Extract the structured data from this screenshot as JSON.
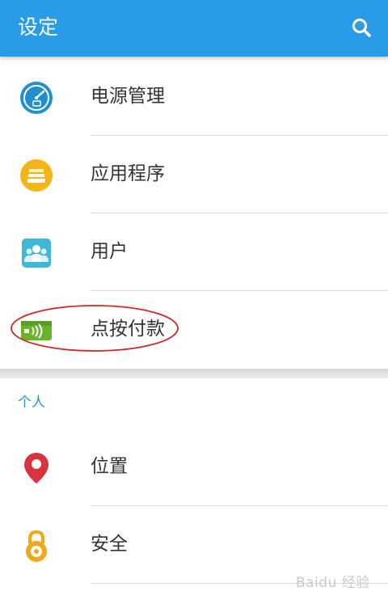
{
  "app_bar": {
    "title": "设定",
    "search_icon": "search-icon"
  },
  "device_section": {
    "items": [
      {
        "label": "电源管理",
        "icon": "power-management-icon"
      },
      {
        "label": "应用程序",
        "icon": "applications-icon"
      },
      {
        "label": "用户",
        "icon": "users-icon"
      },
      {
        "label": "点按付款",
        "icon": "tap-and-pay-icon",
        "highlighted": true
      }
    ]
  },
  "personal_section": {
    "header": "个人",
    "items": [
      {
        "label": "位置",
        "icon": "location-icon"
      },
      {
        "label": "安全",
        "icon": "security-lock-icon"
      }
    ]
  },
  "watermark": "Baidu 经验",
  "colors": {
    "app_bar": "#2a9be6",
    "section_header": "#1e9ad6",
    "highlight_ring": "#cc2a2a"
  }
}
